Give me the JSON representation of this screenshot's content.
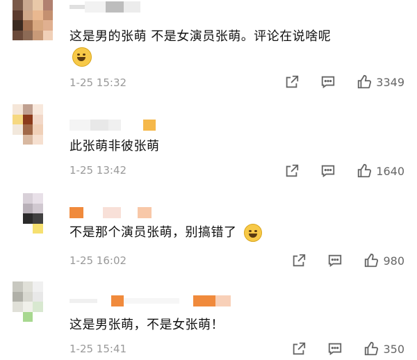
{
  "comments": [
    {
      "text": "这是男的张萌 不是女演员张萌。评论在说啥呢",
      "emoji": "grin-sweat-emoji",
      "time": "1-25 15:32",
      "likes": "3349"
    },
    {
      "text": "此张萌非彼张萌",
      "time": "1-25 13:42",
      "likes": "1640"
    },
    {
      "text": "不是那个演员张萌，别搞错了",
      "emoji": "laugh-cry-emoji",
      "time": "1-25 16:02",
      "likes": "980"
    },
    {
      "text": "这是男张萌，不是女张萌！",
      "time": "1-25 15:41",
      "likes": "350"
    }
  ],
  "colors": {
    "text": "#111111",
    "meta": "#999999",
    "icon": "#666666",
    "blur_orange": "#f08a3c"
  },
  "icons": [
    "share-icon",
    "comment-icon",
    "like-icon"
  ]
}
